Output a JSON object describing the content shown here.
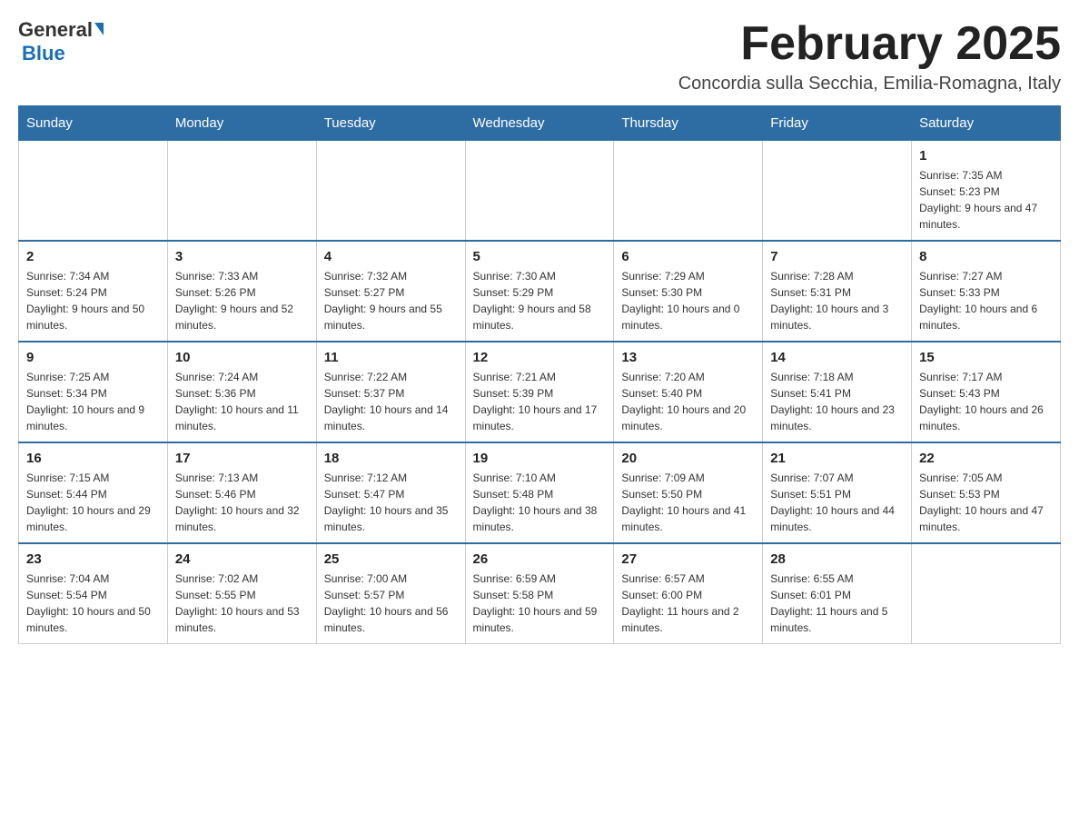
{
  "header": {
    "logo_general": "General",
    "logo_blue": "Blue",
    "title": "February 2025",
    "subtitle": "Concordia sulla Secchia, Emilia-Romagna, Italy"
  },
  "days_of_week": [
    "Sunday",
    "Monday",
    "Tuesday",
    "Wednesday",
    "Thursday",
    "Friday",
    "Saturday"
  ],
  "weeks": [
    {
      "days": [
        {
          "num": "",
          "info": ""
        },
        {
          "num": "",
          "info": ""
        },
        {
          "num": "",
          "info": ""
        },
        {
          "num": "",
          "info": ""
        },
        {
          "num": "",
          "info": ""
        },
        {
          "num": "",
          "info": ""
        },
        {
          "num": "1",
          "info": "Sunrise: 7:35 AM\nSunset: 5:23 PM\nDaylight: 9 hours and 47 minutes."
        }
      ]
    },
    {
      "days": [
        {
          "num": "2",
          "info": "Sunrise: 7:34 AM\nSunset: 5:24 PM\nDaylight: 9 hours and 50 minutes."
        },
        {
          "num": "3",
          "info": "Sunrise: 7:33 AM\nSunset: 5:26 PM\nDaylight: 9 hours and 52 minutes."
        },
        {
          "num": "4",
          "info": "Sunrise: 7:32 AM\nSunset: 5:27 PM\nDaylight: 9 hours and 55 minutes."
        },
        {
          "num": "5",
          "info": "Sunrise: 7:30 AM\nSunset: 5:29 PM\nDaylight: 9 hours and 58 minutes."
        },
        {
          "num": "6",
          "info": "Sunrise: 7:29 AM\nSunset: 5:30 PM\nDaylight: 10 hours and 0 minutes."
        },
        {
          "num": "7",
          "info": "Sunrise: 7:28 AM\nSunset: 5:31 PM\nDaylight: 10 hours and 3 minutes."
        },
        {
          "num": "8",
          "info": "Sunrise: 7:27 AM\nSunset: 5:33 PM\nDaylight: 10 hours and 6 minutes."
        }
      ]
    },
    {
      "days": [
        {
          "num": "9",
          "info": "Sunrise: 7:25 AM\nSunset: 5:34 PM\nDaylight: 10 hours and 9 minutes."
        },
        {
          "num": "10",
          "info": "Sunrise: 7:24 AM\nSunset: 5:36 PM\nDaylight: 10 hours and 11 minutes."
        },
        {
          "num": "11",
          "info": "Sunrise: 7:22 AM\nSunset: 5:37 PM\nDaylight: 10 hours and 14 minutes."
        },
        {
          "num": "12",
          "info": "Sunrise: 7:21 AM\nSunset: 5:39 PM\nDaylight: 10 hours and 17 minutes."
        },
        {
          "num": "13",
          "info": "Sunrise: 7:20 AM\nSunset: 5:40 PM\nDaylight: 10 hours and 20 minutes."
        },
        {
          "num": "14",
          "info": "Sunrise: 7:18 AM\nSunset: 5:41 PM\nDaylight: 10 hours and 23 minutes."
        },
        {
          "num": "15",
          "info": "Sunrise: 7:17 AM\nSunset: 5:43 PM\nDaylight: 10 hours and 26 minutes."
        }
      ]
    },
    {
      "days": [
        {
          "num": "16",
          "info": "Sunrise: 7:15 AM\nSunset: 5:44 PM\nDaylight: 10 hours and 29 minutes."
        },
        {
          "num": "17",
          "info": "Sunrise: 7:13 AM\nSunset: 5:46 PM\nDaylight: 10 hours and 32 minutes."
        },
        {
          "num": "18",
          "info": "Sunrise: 7:12 AM\nSunset: 5:47 PM\nDaylight: 10 hours and 35 minutes."
        },
        {
          "num": "19",
          "info": "Sunrise: 7:10 AM\nSunset: 5:48 PM\nDaylight: 10 hours and 38 minutes."
        },
        {
          "num": "20",
          "info": "Sunrise: 7:09 AM\nSunset: 5:50 PM\nDaylight: 10 hours and 41 minutes."
        },
        {
          "num": "21",
          "info": "Sunrise: 7:07 AM\nSunset: 5:51 PM\nDaylight: 10 hours and 44 minutes."
        },
        {
          "num": "22",
          "info": "Sunrise: 7:05 AM\nSunset: 5:53 PM\nDaylight: 10 hours and 47 minutes."
        }
      ]
    },
    {
      "days": [
        {
          "num": "23",
          "info": "Sunrise: 7:04 AM\nSunset: 5:54 PM\nDaylight: 10 hours and 50 minutes."
        },
        {
          "num": "24",
          "info": "Sunrise: 7:02 AM\nSunset: 5:55 PM\nDaylight: 10 hours and 53 minutes."
        },
        {
          "num": "25",
          "info": "Sunrise: 7:00 AM\nSunset: 5:57 PM\nDaylight: 10 hours and 56 minutes."
        },
        {
          "num": "26",
          "info": "Sunrise: 6:59 AM\nSunset: 5:58 PM\nDaylight: 10 hours and 59 minutes."
        },
        {
          "num": "27",
          "info": "Sunrise: 6:57 AM\nSunset: 6:00 PM\nDaylight: 11 hours and 2 minutes."
        },
        {
          "num": "28",
          "info": "Sunrise: 6:55 AM\nSunset: 6:01 PM\nDaylight: 11 hours and 5 minutes."
        },
        {
          "num": "",
          "info": ""
        }
      ]
    }
  ]
}
